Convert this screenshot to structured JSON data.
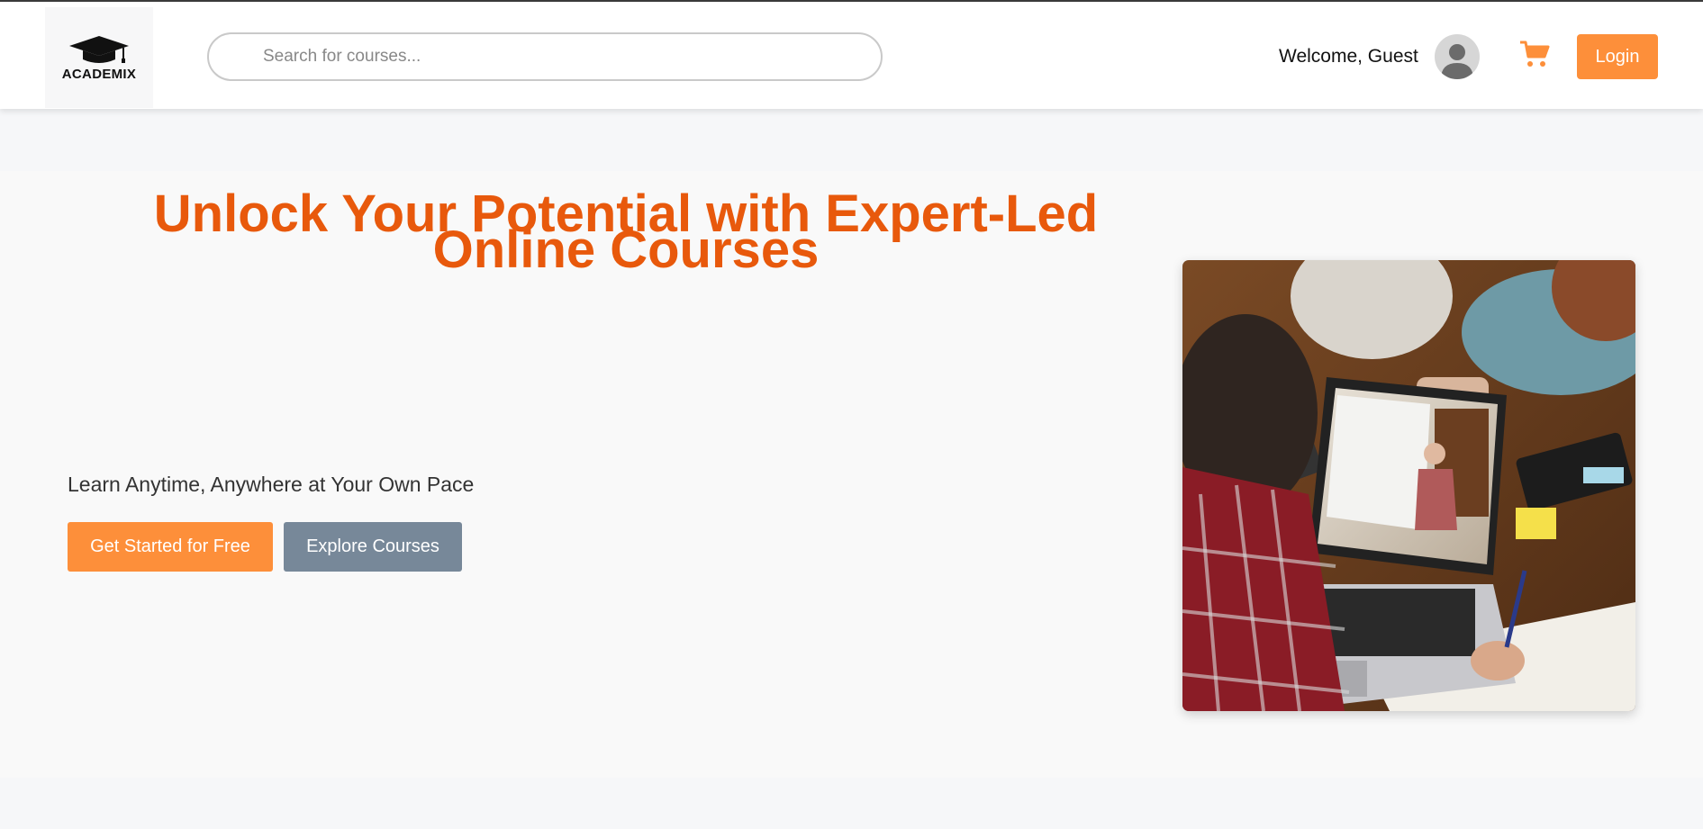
{
  "brand": {
    "name": "ACADEMIX"
  },
  "search": {
    "placeholder": "Search for courses..."
  },
  "user": {
    "welcome": "Welcome, Guest"
  },
  "auth": {
    "login_label": "Login"
  },
  "hero": {
    "title_line1": "Unlock Your Potential with Expert-Led",
    "title_line2": "Online Courses",
    "subtitle": "Learn Anytime, Anywhere at Your Own Pace",
    "primary_cta": "Get Started for Free",
    "secondary_cta": "Explore Courses"
  },
  "icons": {
    "logo": "graduation-cap-icon",
    "avatar": "user-avatar-icon",
    "cart": "shopping-cart-icon"
  },
  "colors": {
    "accent": "#fd8f3a",
    "title": "#e8590c",
    "secondary_button": "#778899",
    "header_bg": "#ffffff",
    "hero_bg": "#f9f9f9"
  }
}
